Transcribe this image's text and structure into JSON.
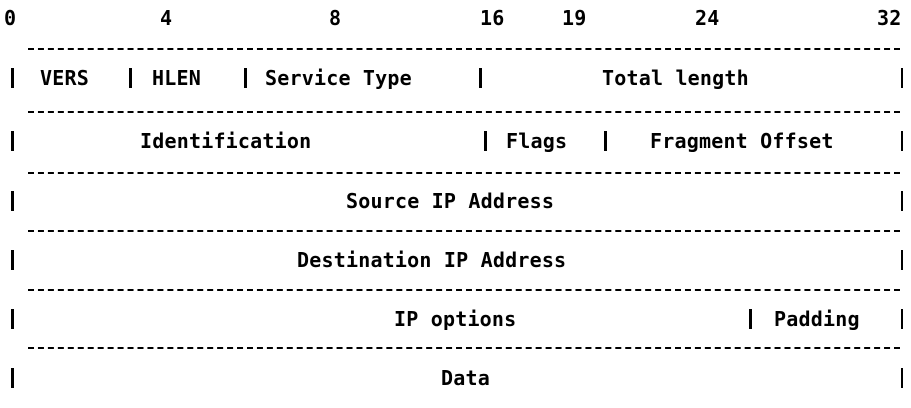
{
  "bit_positions": [
    "0",
    "4",
    "8",
    "16",
    "19",
    "24",
    "32"
  ],
  "rows": [
    {
      "fields": [
        "VERS",
        "HLEN",
        "Service Type",
        "Total length"
      ]
    },
    {
      "fields": [
        "Identification",
        "Flags",
        "Fragment Offset"
      ]
    },
    {
      "fields": [
        "Source IP Address"
      ]
    },
    {
      "fields": [
        "Destination IP Address"
      ]
    },
    {
      "fields": [
        "IP options",
        "Padding"
      ]
    },
    {
      "fields": [
        "Data"
      ]
    }
  ],
  "colors": {
    "text": "#000000",
    "background": "#ffffff"
  }
}
